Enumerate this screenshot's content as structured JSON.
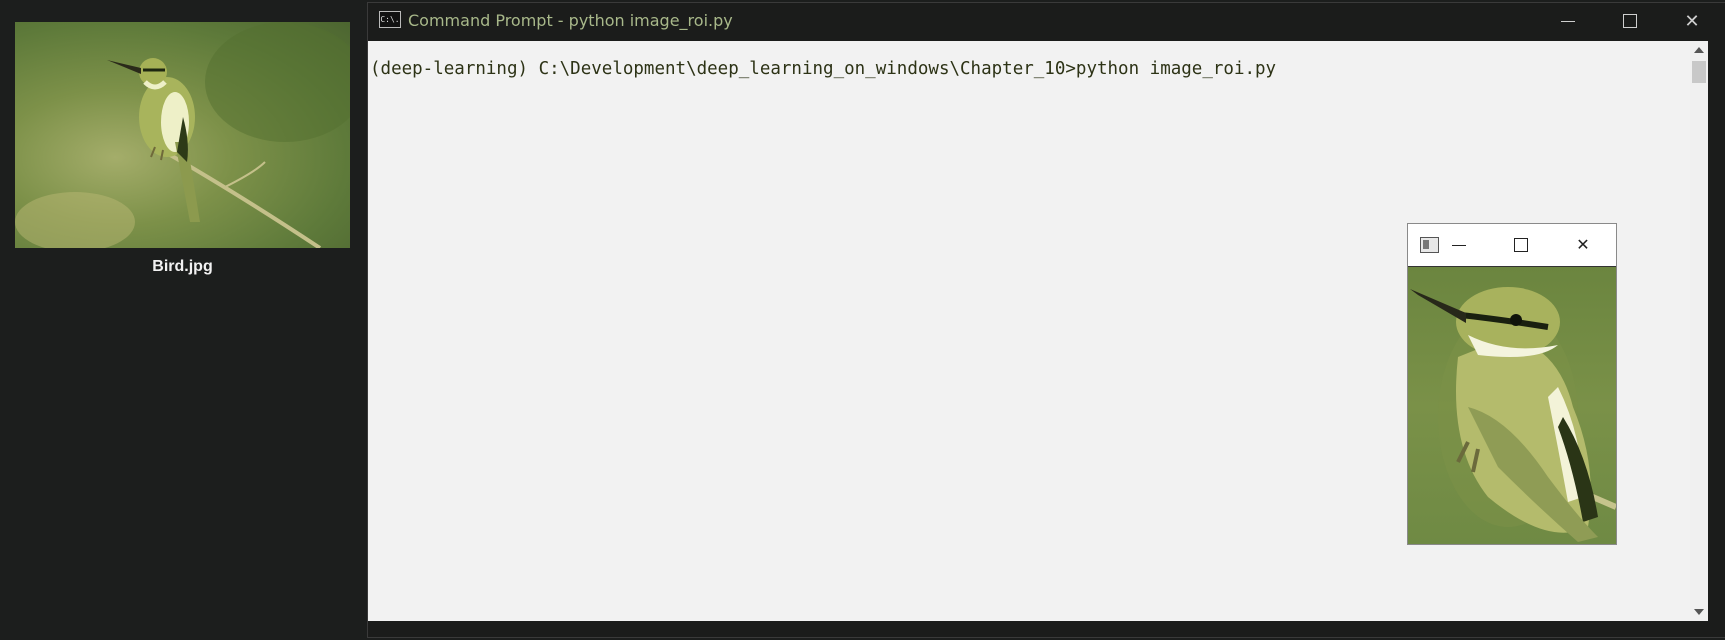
{
  "explorer": {
    "selected_file": "Bird.jpg"
  },
  "cmd_window": {
    "title": "Command Prompt - python  image_roi.py",
    "icon_text": "C:\\.",
    "console_line": "(deep-learning) C:\\Development\\deep_learning_on_windows\\Chapter_10>python image_roi.py",
    "controls": {
      "minimize": "minimize",
      "maximize": "maximize",
      "close": "✕"
    }
  },
  "roi_window": {
    "controls": {
      "minimize": "minimize",
      "maximize": "maximize",
      "close": "✕"
    }
  },
  "icons": {
    "cmd": "cmd-icon",
    "window_app": "window-app-icon"
  }
}
